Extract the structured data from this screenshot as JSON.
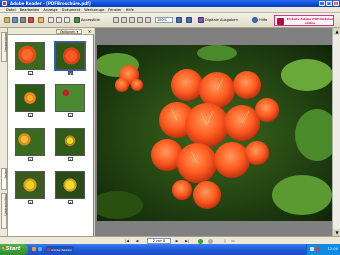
{
  "window": {
    "title": "Adobe Reader - [PDFBroschüre.pdf]",
    "buttons": {
      "minimize": "_",
      "maximize": "□",
      "close": "×"
    }
  },
  "menu": [
    "Datei",
    "Bearbeiten",
    "Anzeige",
    "Dokument",
    "Werkzeuge",
    "Fenster",
    "Hilfe"
  ],
  "toolbar": {
    "accessible_label": "Accessible",
    "zoom_value": "100%",
    "digital_editions_label": "Digitale Ausgaben",
    "help_label": "Hilfe",
    "ad_text": "Erstelle Adobe PDF-Dateien online"
  },
  "nav_panel": {
    "tabs": [
      "Lesezeichen",
      "Seiten",
      "Unterschriften"
    ],
    "options_label": "Optionen ▾",
    "close_glyph": "×",
    "thumbnails": [
      {
        "page": "1",
        "selected": false
      },
      {
        "page": "2",
        "selected": true
      },
      {
        "page": "3",
        "selected": false
      },
      {
        "page": "4",
        "selected": false
      },
      {
        "page": "5",
        "selected": false
      },
      {
        "page": "6",
        "selected": false
      },
      {
        "page": "7",
        "selected": false
      },
      {
        "page": "8",
        "selected": false
      }
    ]
  },
  "status": {
    "page_size": "",
    "page_indicator": "2 von 8",
    "first": "|◀",
    "prev": "◀",
    "next": "▶",
    "last": "▶|"
  },
  "taskbar": {
    "start_label": "Start",
    "task_label": "Adobe Reader",
    "clock": "12:00"
  },
  "colors": {
    "accent": "#2f5fd0",
    "titlebar": "#0a4bd6",
    "start_green": "#2f8c2a",
    "flower_orange": "#ff5a1f"
  }
}
